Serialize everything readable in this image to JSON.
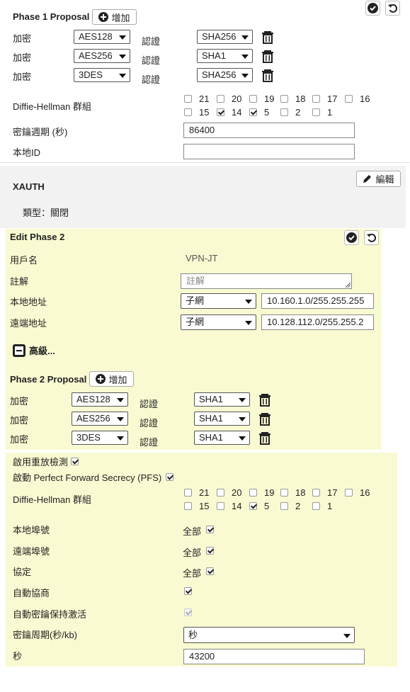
{
  "phase1": {
    "title": "Phase 1 Proposal",
    "add_label": "增加",
    "rows": [
      {
        "enc_label": "加密",
        "enc_value": "AES128",
        "auth_label": "認證",
        "auth_value": "SHA256"
      },
      {
        "enc_label": "加密",
        "enc_value": "AES256",
        "auth_label": "認證",
        "auth_value": "SHA1"
      },
      {
        "enc_label": "加密",
        "enc_value": "3DES",
        "auth_label": "認證",
        "auth_value": "SHA256"
      }
    ],
    "dh_label": "Diffie-Hellman 群組",
    "dh_groups": [
      {
        "num": "21",
        "checked": false
      },
      {
        "num": "20",
        "checked": false
      },
      {
        "num": "19",
        "checked": false
      },
      {
        "num": "18",
        "checked": false
      },
      {
        "num": "17",
        "checked": false
      },
      {
        "num": "16",
        "checked": false
      },
      {
        "num": "15",
        "checked": false
      },
      {
        "num": "14",
        "checked": true
      },
      {
        "num": "5",
        "checked": true
      },
      {
        "num": "2",
        "checked": false
      },
      {
        "num": "1",
        "checked": false
      }
    ],
    "keylife_label": "密鑰週期 (秒)",
    "keylife_value": "86400",
    "localid_label": "本地ID",
    "localid_value": ""
  },
  "xauth": {
    "title": "XAUTH",
    "edit_label": "編輯",
    "type_text": "類型：關閉"
  },
  "phase2": {
    "title": "Edit Phase 2",
    "name_label": "用戶名",
    "name_value": "VPN-JT",
    "comment_label": "註解",
    "comment_placeholder": "註解",
    "local_addr_label": "本地地址",
    "local_addr_type": "子網",
    "local_addr_value": "10.160.1.0/255.255.255",
    "remote_addr_label": "遠端地址",
    "remote_addr_type": "子網",
    "remote_addr_value": "10.128.112.0/255.255.2",
    "advanced_label": "高級...",
    "proposal_title": "Phase 2 Proposal",
    "add_label": "增加",
    "rows": [
      {
        "enc_label": "加密",
        "enc_value": "AES128",
        "auth_label": "認證",
        "auth_value": "SHA1"
      },
      {
        "enc_label": "加密",
        "enc_value": "AES256",
        "auth_label": "認證",
        "auth_value": "SHA1"
      },
      {
        "enc_label": "加密",
        "enc_value": "3DES",
        "auth_label": "認證",
        "auth_value": "SHA1"
      }
    ]
  },
  "advanced": {
    "replay_label": "啟用重放檢測",
    "replay_checked": true,
    "pfs_label": "啟動 Perfect Forward Secrecy (PFS)",
    "pfs_checked": true,
    "dh_label": "Diffie-Hellman 群組",
    "dh_groups": [
      {
        "num": "21",
        "checked": false
      },
      {
        "num": "20",
        "checked": false
      },
      {
        "num": "19",
        "checked": false
      },
      {
        "num": "18",
        "checked": false
      },
      {
        "num": "17",
        "checked": false
      },
      {
        "num": "16",
        "checked": false
      },
      {
        "num": "15",
        "checked": false
      },
      {
        "num": "14",
        "checked": false
      },
      {
        "num": "5",
        "checked": true
      },
      {
        "num": "2",
        "checked": false
      },
      {
        "num": "1",
        "checked": false
      }
    ],
    "local_port_label": "本地埠號",
    "local_port_value": "全部",
    "remote_port_label": "遠端埠號",
    "remote_port_value": "全部",
    "protocol_label": "協定",
    "protocol_value": "全部",
    "autonegotiate_label": "自動協商",
    "keepalive_label": "自動密鑰保持激活",
    "keylife_type_label": "密鑰周期(秒/kb)",
    "keylife_type_value": "秒",
    "seconds_label": "秒",
    "seconds_value": "43200"
  }
}
